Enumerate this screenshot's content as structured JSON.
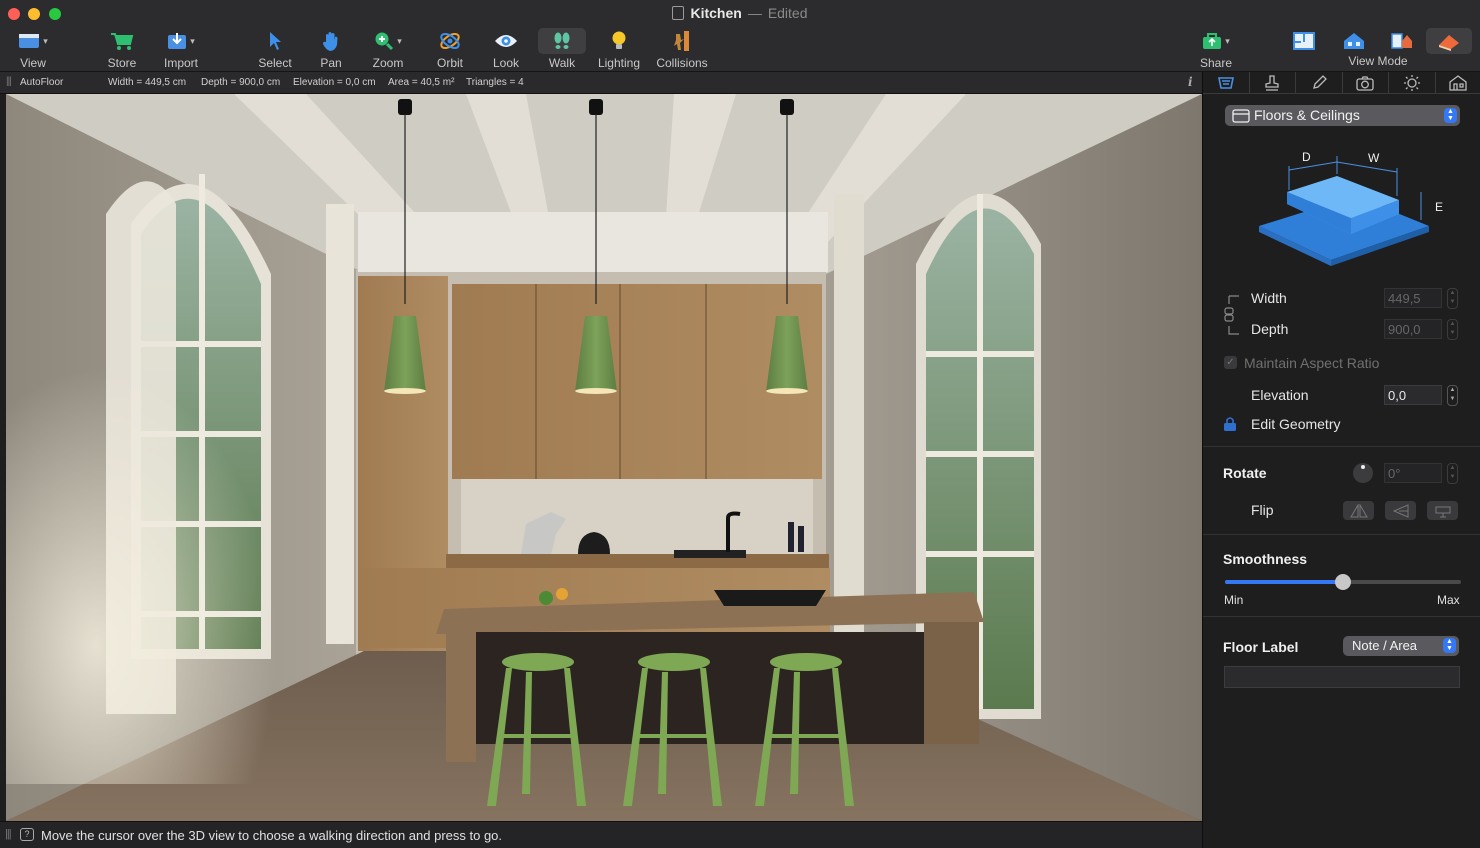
{
  "window": {
    "title": "Kitchen",
    "state": "Edited"
  },
  "toolbar": {
    "view": "View",
    "store": "Store",
    "import": "Import",
    "select": "Select",
    "pan": "Pan",
    "zoom": "Zoom",
    "orbit": "Orbit",
    "look": "Look",
    "walk": "Walk",
    "lighting": "Lighting",
    "collisions": "Collisions",
    "share": "Share",
    "view_mode": "View Mode",
    "active_tool": "Walk"
  },
  "infobar": {
    "object": "AutoFloor",
    "width": "Width = 449,5 cm",
    "depth": "Depth = 900,0 cm",
    "elevation": "Elevation = 0,0 cm",
    "area": "Area = 40,5 m²",
    "triangles": "Triangles = 4",
    "info_icon": "i"
  },
  "status": {
    "message": "Move the cursor over the 3D view to choose a walking direction and press to go."
  },
  "inspector": {
    "category": "Floors & Ceilings",
    "diagram": {
      "d": "D",
      "w": "W",
      "e": "E"
    },
    "width_label": "Width",
    "width_value": "449,5",
    "depth_label": "Depth",
    "depth_value": "900,0",
    "aspect_label": "Maintain Aspect Ratio",
    "elevation_label": "Elevation",
    "elevation_value": "0,0",
    "edit_geometry": "Edit Geometry",
    "rotate_title": "Rotate",
    "rotate_value": "0°",
    "flip_label": "Flip",
    "smoothness_title": "Smoothness",
    "smoothness_level": 0.5,
    "min_label": "Min",
    "max_label": "Max",
    "floor_label_title": "Floor Label",
    "floor_label_value": "Note / Area",
    "floor_label_text": ""
  },
  "colors": {
    "accent": "#3478f6",
    "panel": "#1e1e1f",
    "toolbar": "#2c2c2e",
    "cabinet_wood": "#a98458",
    "lamp_green": "#6f9350",
    "stool_green": "#7fa854"
  }
}
